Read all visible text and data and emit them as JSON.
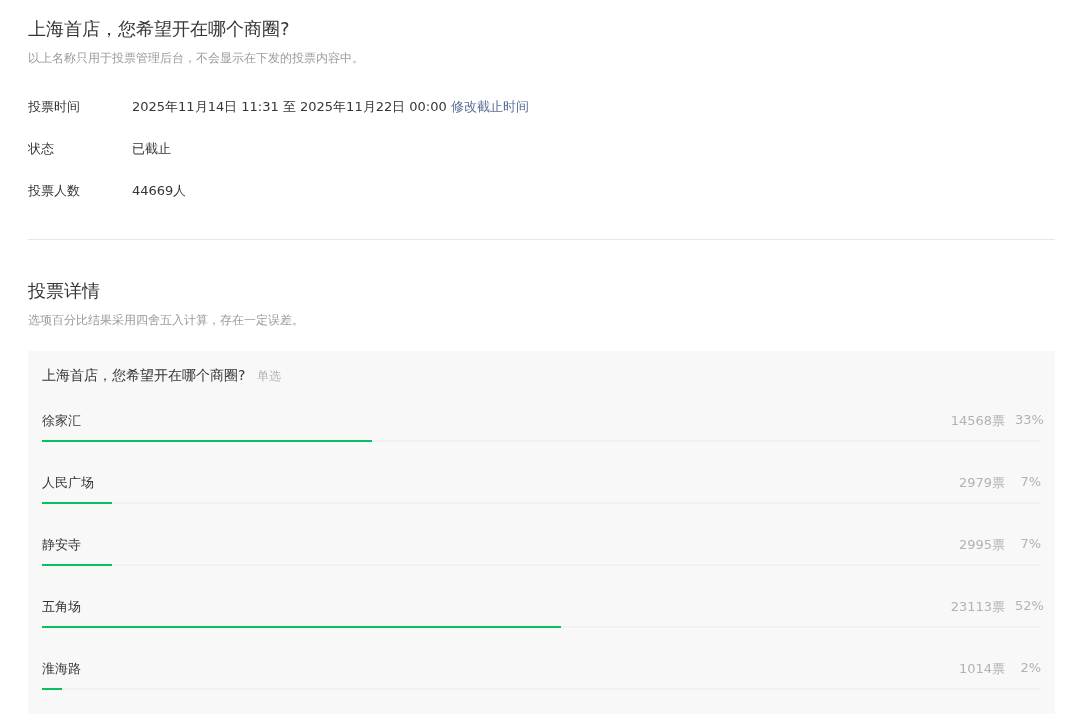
{
  "title": "上海首店，您希望开在哪个商圈?",
  "subtitle": "以上名称只用于投票管理后台，不会显示在下发的投票内容中。",
  "info": [
    {
      "label": "投票时间",
      "value": "2025年11月14日 11:31 至 2025年11月22日 00:00",
      "link": "修改截止时间"
    },
    {
      "label": "状态",
      "value": "已截止"
    },
    {
      "label": "投票人数",
      "value": "44669人"
    }
  ],
  "details": {
    "title": "投票详情",
    "note": "选项百分比结果采用四舍五入计算，存在一定误差。",
    "question": {
      "title": "上海首店，您希望开在哪个商圈?",
      "type_label": "单选",
      "options": [
        {
          "name": "徐家汇",
          "votes": "14568票",
          "percent": "33%",
          "level": 0.33
        },
        {
          "name": "人民广场",
          "votes": "2979票",
          "percent": "7%",
          "level": 0.07
        },
        {
          "name": "静安寺",
          "votes": "2995票",
          "percent": "7%",
          "level": 0.07
        },
        {
          "name": "五角场",
          "votes": "23113票",
          "percent": "52%",
          "level": 0.52
        },
        {
          "name": "淮海路",
          "votes": "1014票",
          "percent": "2%",
          "level": 0.02
        }
      ]
    }
  }
}
